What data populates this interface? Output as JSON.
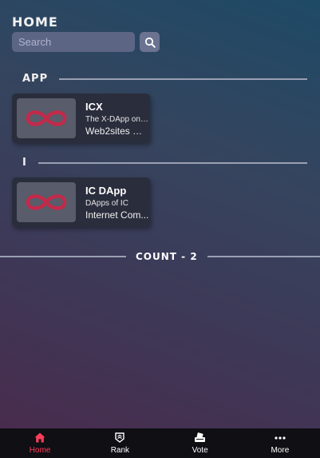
{
  "header": {
    "title": "HOME"
  },
  "search": {
    "placeholder": "Search"
  },
  "sections": [
    {
      "label": "APP",
      "cards": [
        {
          "title": "ICX",
          "description": "The X-DApp on ...",
          "owner": "Web2sites Or..."
        }
      ]
    },
    {
      "label": "I",
      "cards": [
        {
          "title": "IC DApp",
          "description": "DApps of IC",
          "owner": "Internet Com..."
        }
      ]
    }
  ],
  "count": {
    "label": "COUNT - 2"
  },
  "nav": {
    "items": [
      {
        "label": "Home",
        "icon": "home-icon",
        "active": true
      },
      {
        "label": "Rank",
        "icon": "rank-icon",
        "active": false
      },
      {
        "label": "Vote",
        "icon": "vote-icon",
        "active": false
      },
      {
        "label": "More",
        "icon": "more-icon",
        "active": false
      }
    ]
  },
  "colors": {
    "accent": "#ff3d5a",
    "logo": "#c22a4a",
    "card": "#2a2d3c",
    "nav_bg": "#0f0f14"
  }
}
